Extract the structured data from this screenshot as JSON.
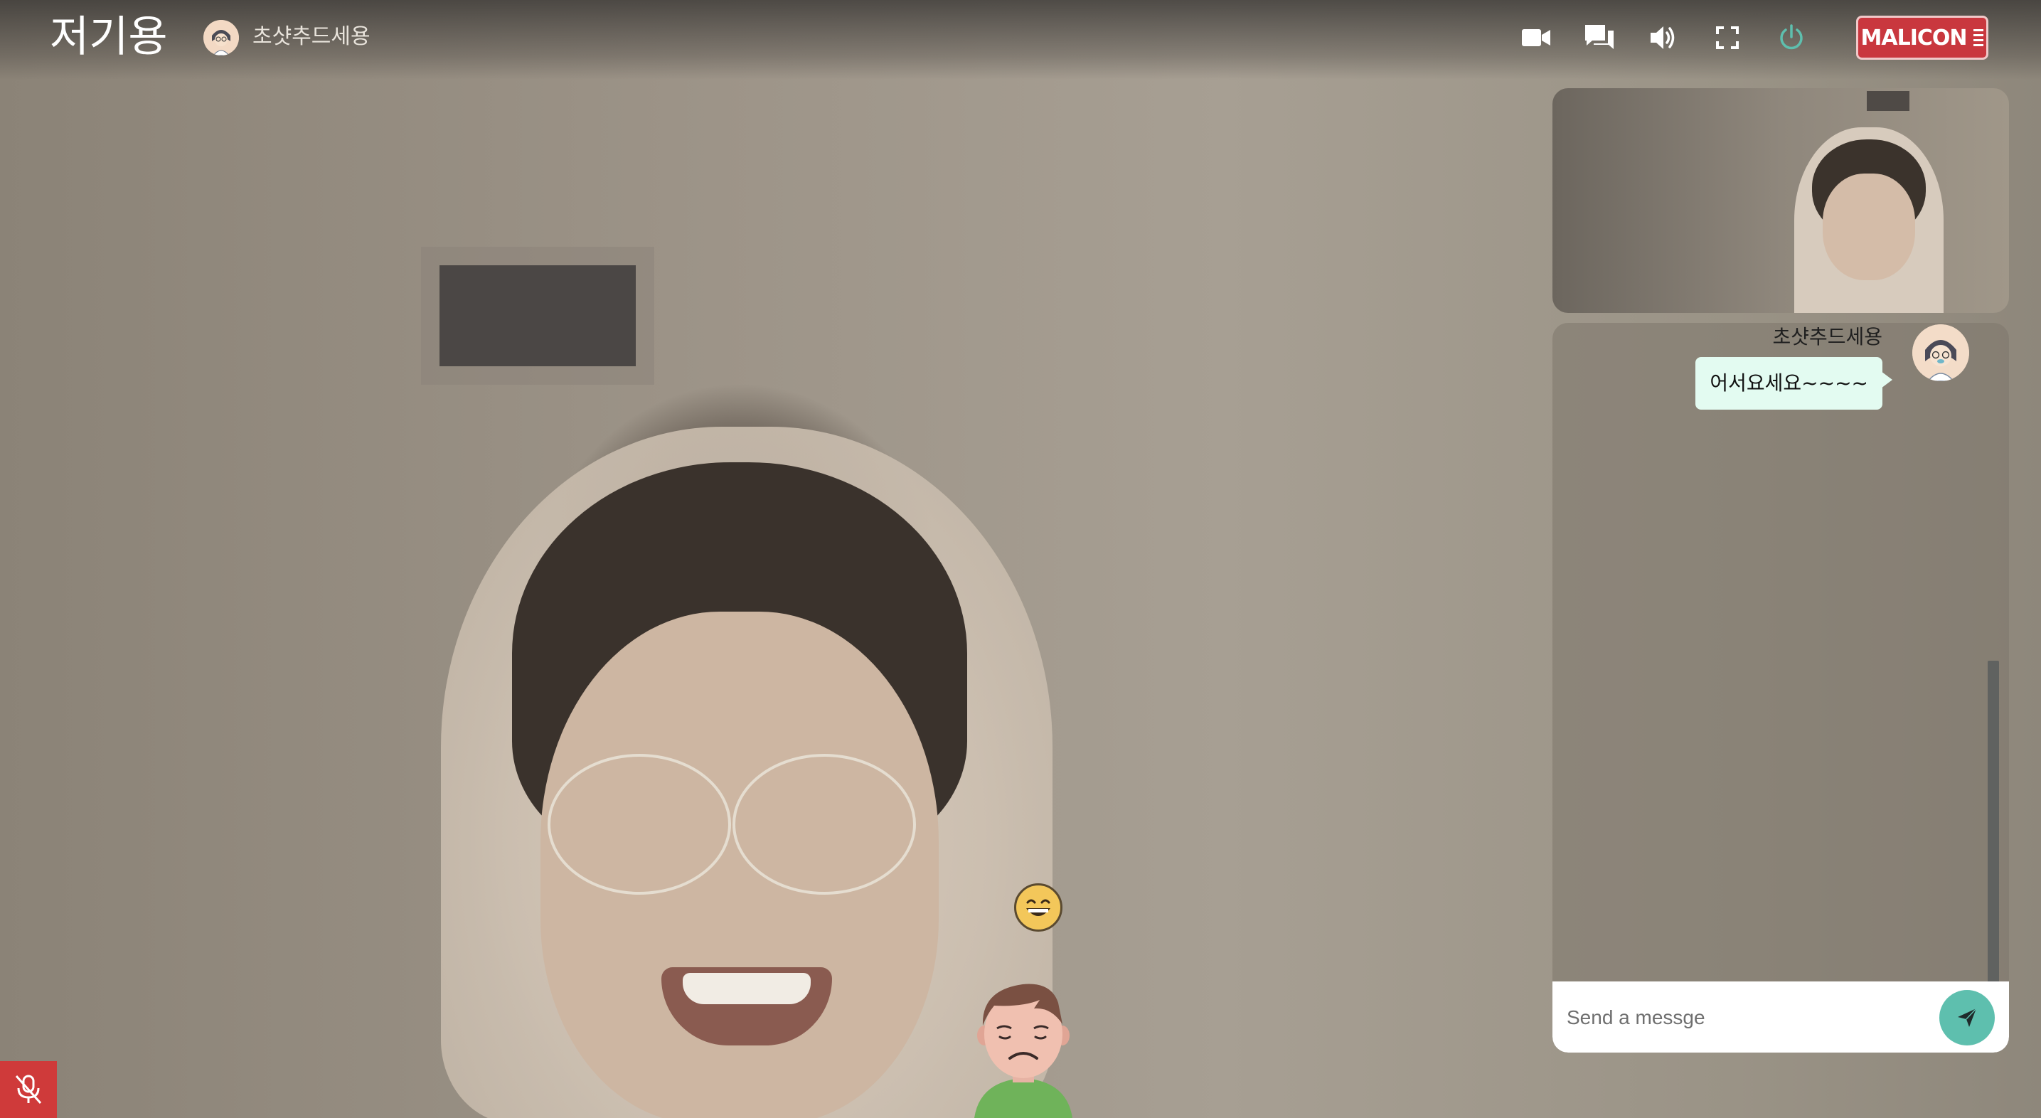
{
  "room": {
    "title": "저기용"
  },
  "host": {
    "name": "초샷추드세용",
    "avatar_icon": "user-avatar-icon"
  },
  "toolbar": {
    "icons": [
      "video-camera-icon",
      "chat-icon",
      "volume-icon",
      "fullscreen-icon",
      "power-icon"
    ],
    "power_color": "#5ebfae"
  },
  "brand": {
    "logo_text": "MALICON",
    "color": "#c9373e"
  },
  "chat": {
    "messages": [
      {
        "sender": "초샷추드세용",
        "text": "어서요세요~~~~",
        "bubble_color": "#e3fbf1"
      }
    ],
    "input": {
      "placeholder": "Send a messge",
      "value": ""
    },
    "send_icon": "send-icon",
    "send_button_color": "#5ebfae"
  },
  "reaction": {
    "emoji": "😁"
  },
  "status": {
    "mic_icon": "mic-off-icon",
    "mic_muted": true,
    "mute_color": "#cf3a3a"
  }
}
